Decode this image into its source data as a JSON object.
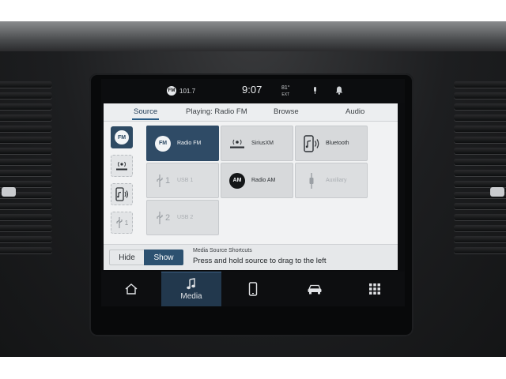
{
  "status": {
    "radio_badge": "FM",
    "station": "101.7",
    "time": "9:07",
    "temperature": "81°",
    "temperature_sub": "EXT"
  },
  "tabs": [
    {
      "label": "Source",
      "active": true
    },
    {
      "label": "Playing: Radio FM",
      "active": false
    },
    {
      "label": "Browse",
      "active": false
    },
    {
      "label": "Audio",
      "active": false
    }
  ],
  "quick_sources": [
    {
      "icon": "fm-badge-icon",
      "text": "FM",
      "active": true
    },
    {
      "icon": "siriusxm-logo-icon",
      "active": false
    },
    {
      "icon": "bluetooth-phone-icon",
      "active": false
    },
    {
      "icon": "usb-icon",
      "text": "1",
      "active": false
    }
  ],
  "sources": [
    {
      "label": "Radio FM",
      "icon": "fm-badge-icon",
      "badge": "FM",
      "state": "active"
    },
    {
      "label": "SiriusXM",
      "icon": "siriusxm-logo-icon",
      "state": "normal"
    },
    {
      "label": "Bluetooth",
      "icon": "bluetooth-phone-icon",
      "state": "normal"
    },
    {
      "label": "USB 1",
      "icon": "usb-icon",
      "number": "1",
      "state": "disabled"
    },
    {
      "label": "Radio AM",
      "icon": "am-badge-icon",
      "badge": "AM",
      "state": "normal"
    },
    {
      "label": "Auxiliary",
      "icon": "aux-cable-icon",
      "state": "disabled"
    },
    {
      "label": "USB 2",
      "icon": "usb-icon",
      "number": "2",
      "state": "disabled"
    }
  ],
  "shortcuts": {
    "hide_label": "Hide",
    "show_label": "Show",
    "selected": "Show",
    "title": "Media Source Shortcuts",
    "text": "Press and hold source to drag to the left"
  },
  "nav": [
    {
      "icon": "home-icon",
      "label": "",
      "active": false
    },
    {
      "icon": "music-note-icon",
      "label": "Media",
      "active": true
    },
    {
      "icon": "phone-icon",
      "label": "",
      "active": false
    },
    {
      "icon": "vehicle-icon",
      "label": "",
      "active": false
    },
    {
      "icon": "apps-grid-icon",
      "label": "",
      "active": false
    }
  ],
  "colors": {
    "accent": "#2f4b66",
    "screen_bg": "#f1f2f3",
    "nav_bg": "#0d0e10"
  }
}
